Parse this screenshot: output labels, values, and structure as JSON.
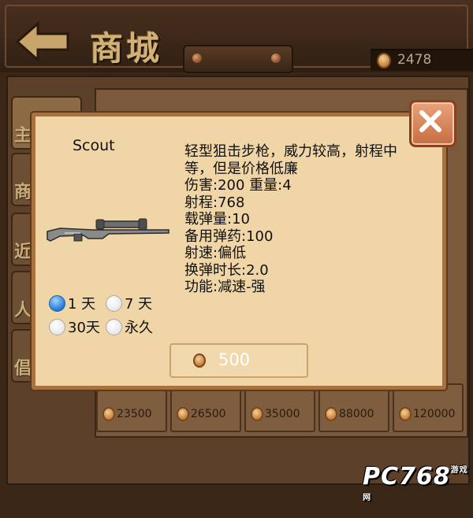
{
  "header": {
    "title": "商城",
    "coin_balance": "2478"
  },
  "categories": [
    "主",
    "商",
    "近",
    "人",
    "倡"
  ],
  "shop": {
    "prices": [
      "23500",
      "26500",
      "35000",
      "88000",
      "120000"
    ]
  },
  "dialog": {
    "item_name": "Scout",
    "description_lines": [
      "轻型狙击步枪，威力较高，射程中等，但是价格低廉",
      "伤害:200 重量:4",
      "射程:768",
      "载弹量:10",
      "备用弹药:100",
      "射速:偏低",
      "换弹时长:2.0",
      "功能:减速-强"
    ],
    "durations": [
      {
        "label": "1 天",
        "selected": true
      },
      {
        "label": "7 天",
        "selected": false
      },
      {
        "label": "30天",
        "selected": false
      },
      {
        "label": "永久",
        "selected": false
      }
    ],
    "buy_price": "500"
  },
  "watermark": {
    "text": "PC768",
    "suffix": "游戏网"
  },
  "colors": {
    "dialog_bg": "#f0d5a6",
    "dialog_border": "#a9713e",
    "close_button": "#d57a4f",
    "radio_selected": "#1a72d4"
  },
  "icons": [
    "back-arrow-icon",
    "coin-icon",
    "close-icon",
    "sniper-rifle-icon",
    "radio-icon"
  ]
}
